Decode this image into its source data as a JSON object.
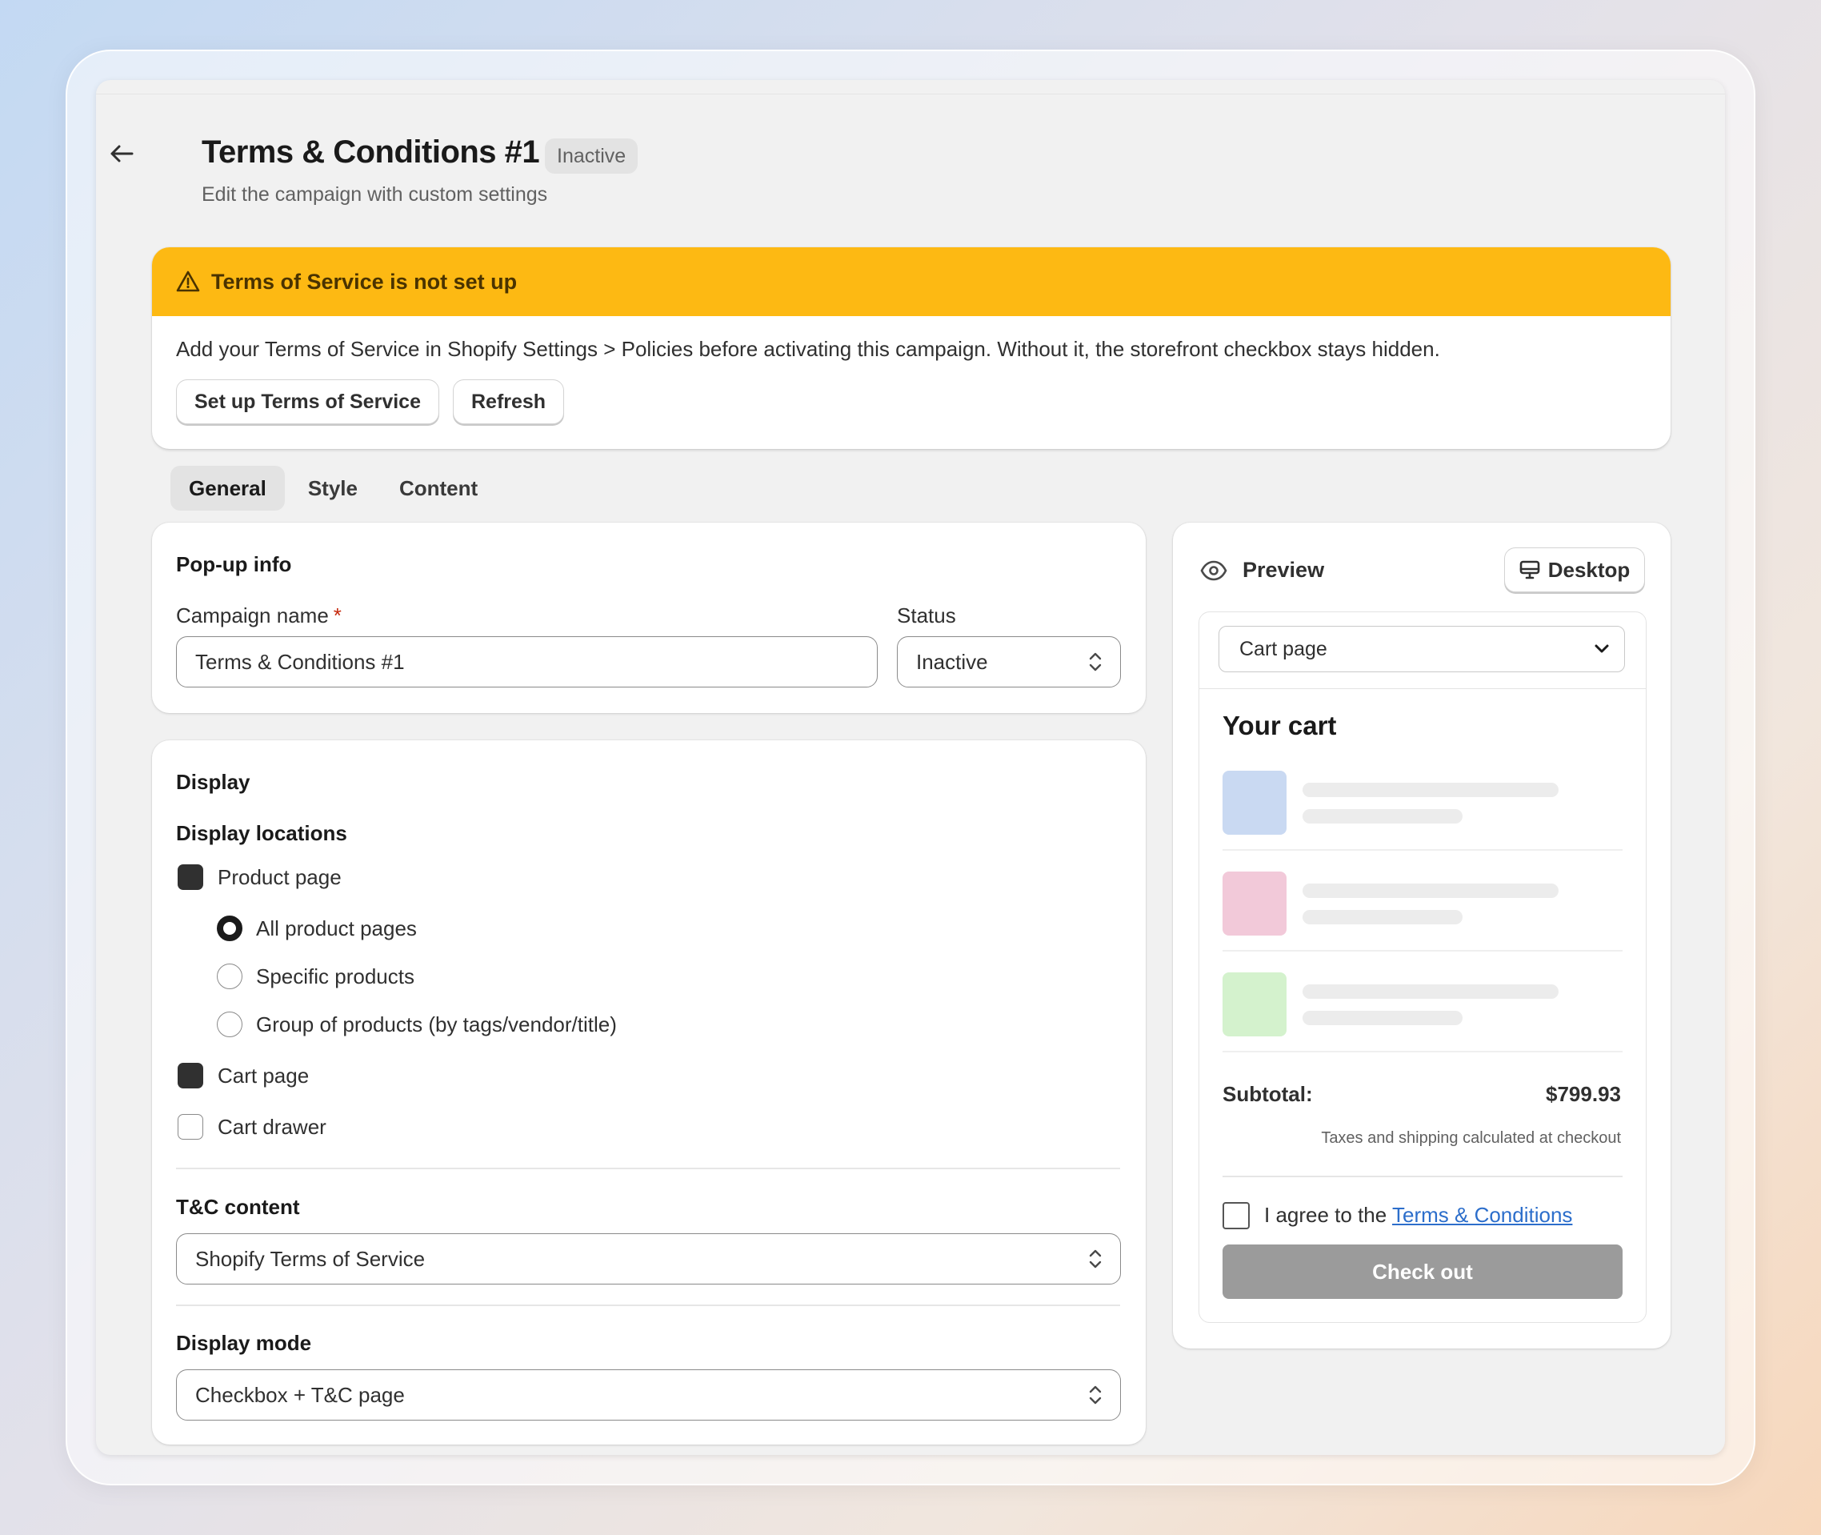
{
  "header": {
    "title": "Terms & Conditions #1",
    "status_badge": "Inactive",
    "subtitle": "Edit the campaign with custom settings"
  },
  "banner": {
    "title": "Terms of Service is not set up",
    "message": "Add your Terms of Service in Shopify Settings > Policies before activating this campaign. Without it, the storefront checkbox stays hidden.",
    "setup_button": "Set up Terms of Service",
    "refresh_button": "Refresh",
    "color": "#fdb913"
  },
  "tabs": [
    {
      "label": "General",
      "active": true
    },
    {
      "label": "Style",
      "active": false
    },
    {
      "label": "Content",
      "active": false
    }
  ],
  "popup_info": {
    "title": "Pop-up info",
    "campaign_name_label": "Campaign name",
    "required_mark": "*",
    "campaign_name_value": "Terms & Conditions #1",
    "status_label": "Status",
    "status_value": "Inactive"
  },
  "display": {
    "title": "Display",
    "locations_label": "Display locations",
    "product_page": {
      "label": "Product page",
      "checked": true
    },
    "product_options": [
      {
        "label": "All product pages",
        "selected": true
      },
      {
        "label": "Specific products",
        "selected": false
      },
      {
        "label": "Group of products (by tags/vendor/title)",
        "selected": false
      }
    ],
    "cart_page": {
      "label": "Cart page",
      "checked": true
    },
    "cart_drawer": {
      "label": "Cart drawer",
      "checked": false
    },
    "tc_content_label": "T&C content",
    "tc_content_value": "Shopify Terms of Service",
    "display_mode_label": "Display mode",
    "display_mode_value": "Checkbox + T&C page"
  },
  "preview": {
    "title": "Preview",
    "device_button": "Desktop",
    "page_select": "Cart page",
    "cart_title": "Your cart",
    "item_colors": [
      "#c9d9f2",
      "#f2c9d9",
      "#d4f2cd"
    ],
    "subtotal_label": "Subtotal:",
    "subtotal_value": "$799.93",
    "tax_note": "Taxes and shipping calculated at checkout",
    "agree_prefix": "I agree to the",
    "agree_link": "Terms & Conditions",
    "checkout_button": "Check out"
  }
}
